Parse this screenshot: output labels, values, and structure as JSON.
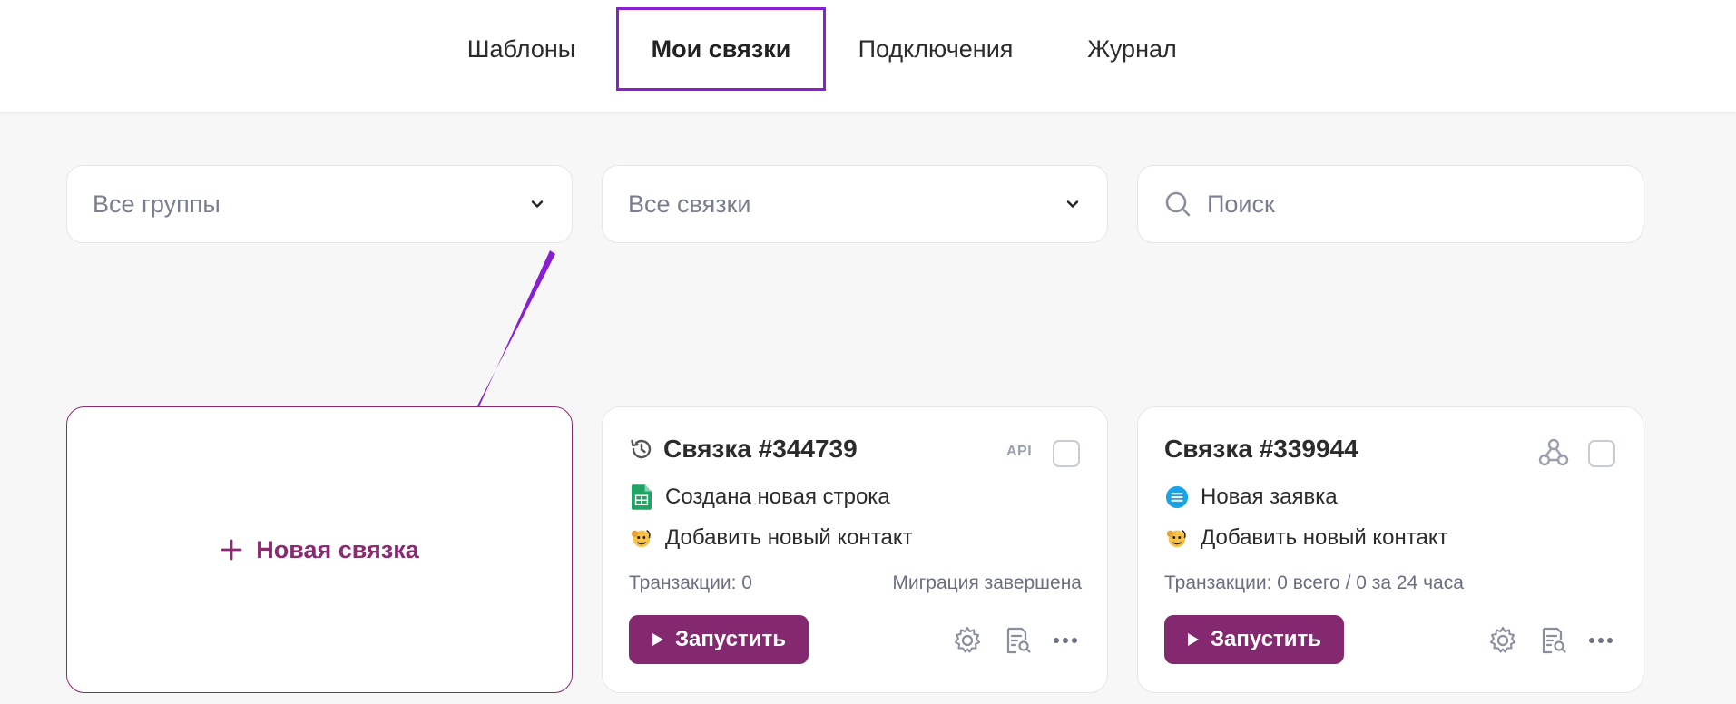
{
  "nav": {
    "tabs": [
      {
        "label": "Шаблоны",
        "active": false
      },
      {
        "label": "Мои связки",
        "active": true
      },
      {
        "label": "Подключения",
        "active": false
      },
      {
        "label": "Журнал",
        "active": false
      }
    ],
    "active_outline_color": "#8a1fd1"
  },
  "filters": {
    "groups": {
      "value": "Все группы",
      "icon": "chevron-down-icon"
    },
    "links": {
      "value": "Все связки",
      "icon": "chevron-down-icon"
    },
    "search": {
      "placeholder": "Поиск",
      "icon": "search-icon"
    }
  },
  "new_card": {
    "label": "Новая связка",
    "icon": "plus-icon",
    "accent": "#8a2a72"
  },
  "cards": [
    {
      "title": "Связка #344739",
      "title_icon": "history-icon",
      "badge": "API",
      "steps": [
        {
          "label": "Создана новая строка",
          "icon": "google-sheets-icon"
        },
        {
          "label": "Добавить новый контакт",
          "icon": "mailchimp-icon"
        }
      ],
      "transactions": "Транзакции: 0",
      "status": "Миграция завершена",
      "run_label": "Запустить"
    },
    {
      "title": "Связка #339944",
      "badge_icon": "webhook-icon",
      "steps": [
        {
          "label": "Новая заявка",
          "icon": "form-icon"
        },
        {
          "label": "Добавить новый контакт",
          "icon": "mailchimp-icon"
        }
      ],
      "transactions": "Транзакции: 0 всего / 0 за 24 часа",
      "run_label": "Запустить"
    }
  ],
  "colors": {
    "run_button": "#84286f",
    "annotation_arrow": "#8a1fd1"
  }
}
